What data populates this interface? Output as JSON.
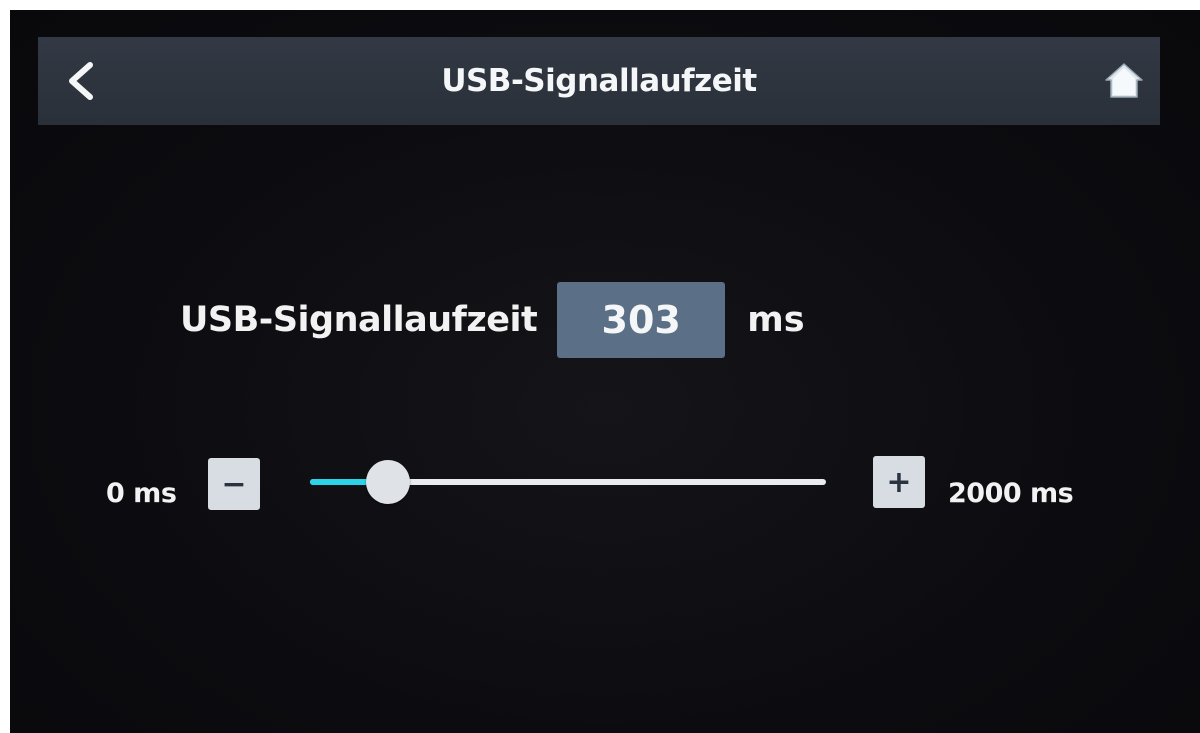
{
  "header": {
    "title": "USB-Signallaufzeit",
    "back_icon": "chevron-left-icon",
    "home_icon": "home-icon"
  },
  "setting": {
    "label": "USB-Signallaufzeit",
    "value": "303",
    "unit": "ms"
  },
  "slider": {
    "min_label": "0 ms",
    "max_label": "2000 ms",
    "min_value": 0,
    "max_value": 2000,
    "current_value": 303,
    "decrement_label": "−",
    "increment_label": "+"
  },
  "colors": {
    "accent": "#2ad3e6",
    "header_bg": "#2f3540",
    "value_box_bg": "#5b6f87",
    "screen_bg": "#0c0c10"
  }
}
